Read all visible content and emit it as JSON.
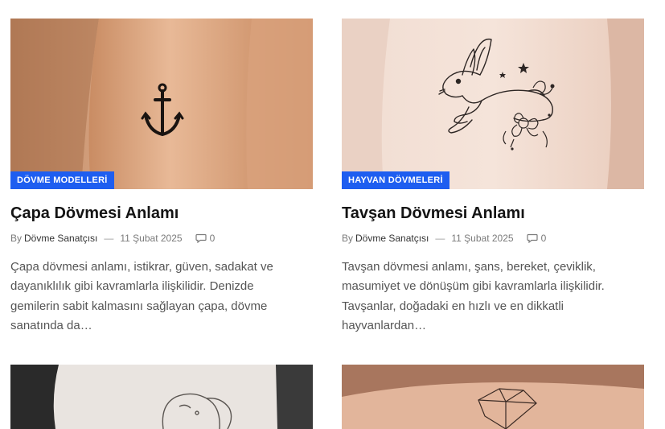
{
  "posts": [
    {
      "category": "DÖVME MODELLERİ",
      "title": "Çapa Dövmesi Anlamı",
      "by": "By",
      "author": "Dövme Sanatçısı",
      "separator": "—",
      "date": "11 Şubat 2025",
      "comments": "0",
      "excerpt": "Çapa dövmesi anlamı, istikrar, güven, sadakat ve dayanıklılık gibi kavramlarla ilişkilidir. Denizde gemilerin sabit kalmasını sağlayan çapa, dövme sanatında da…"
    },
    {
      "category": "HAYVAN DÖVMELERİ",
      "title": "Tavşan Dövmesi Anlamı",
      "by": "By",
      "author": "Dövme Sanatçısı",
      "separator": "—",
      "date": "11 Şubat 2025",
      "comments": "0",
      "excerpt": "Tavşan dövmesi anlamı, şans, bereket, çeviklik, masumiyet ve dönüşüm gibi kavramlarla ilişkilidir. Tavşanlar, doğadaki en hızlı ve en dikkatli hayvanlardan…"
    }
  ],
  "colors": {
    "category_bg": "#1e5ef0",
    "title": "#141414",
    "meta": "#7a7a7a",
    "excerpt": "#555555"
  },
  "icons": {
    "comment": "comment-bubble-icon"
  }
}
